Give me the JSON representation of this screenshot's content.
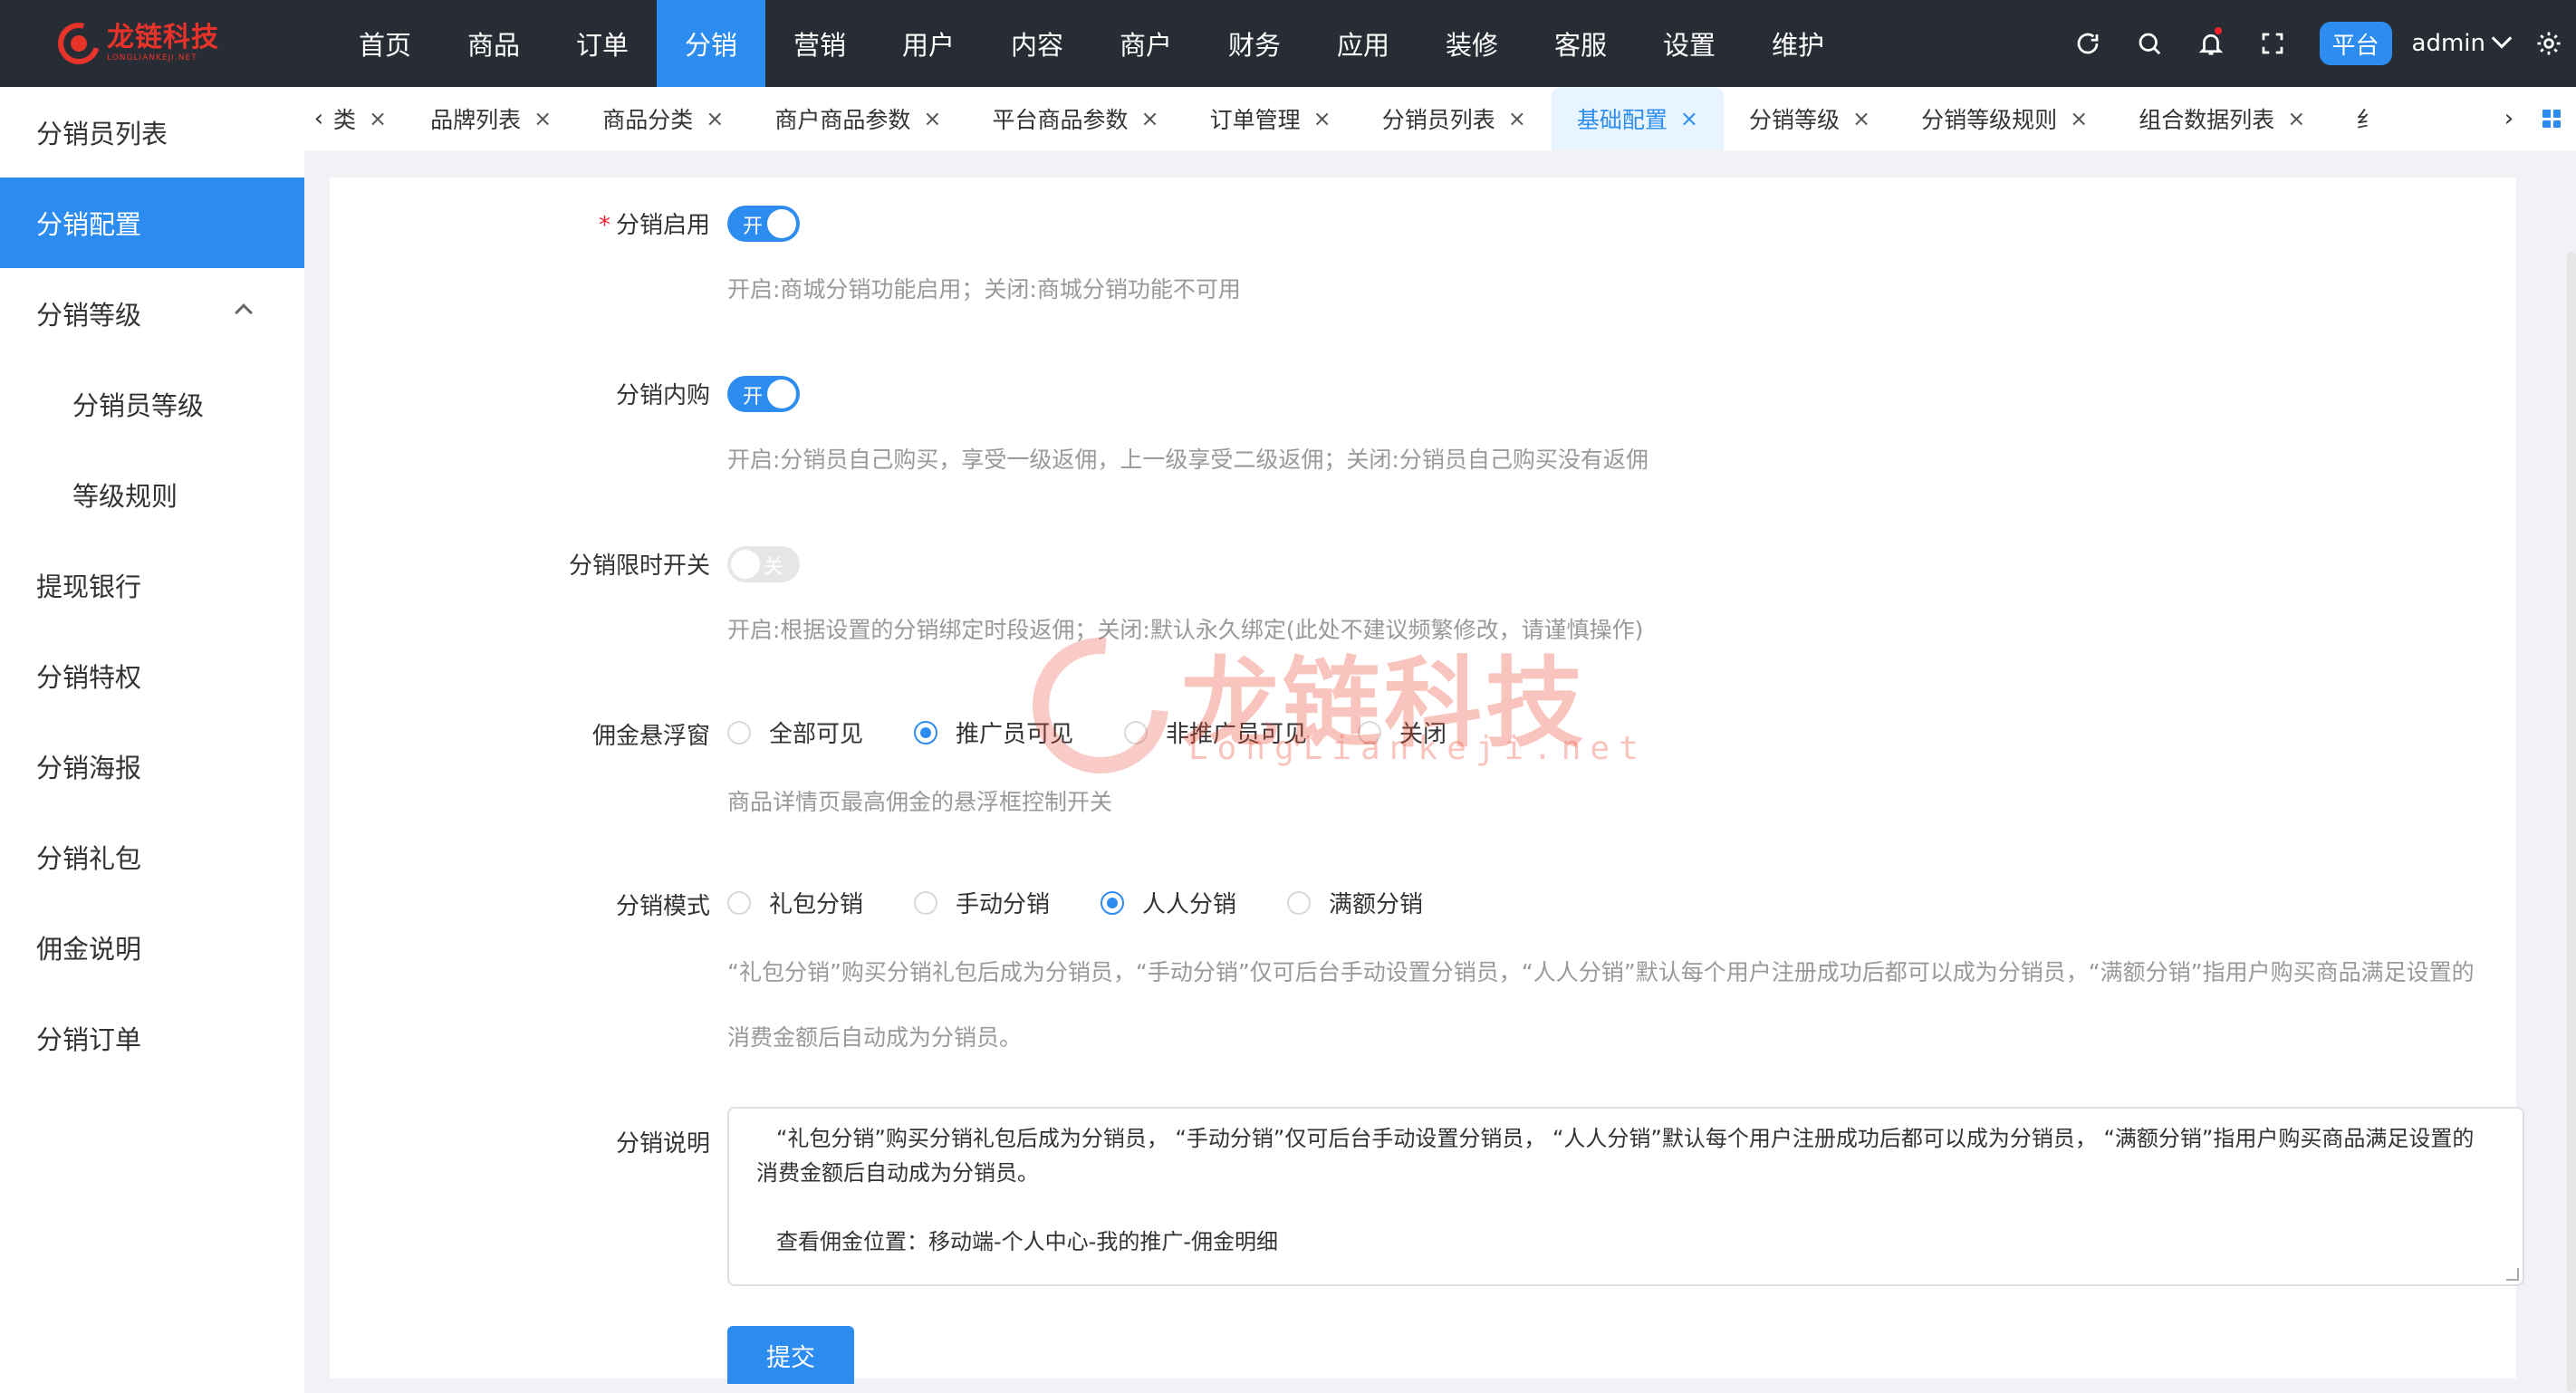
{
  "logo": {
    "name": "龙链科技",
    "subtitle": "LONGLIANKEJI.NET"
  },
  "topnav": [
    "首页",
    "商品",
    "订单",
    "分销",
    "营销",
    "用户",
    "内容",
    "商户",
    "财务",
    "应用",
    "装修",
    "客服",
    "设置",
    "维护"
  ],
  "topnav_active": "分销",
  "header": {
    "platform_label": "平台",
    "user": "admin"
  },
  "sidebar": {
    "items": [
      {
        "label": "分销员列表"
      },
      {
        "label": "分销配置"
      },
      {
        "label": "分销等级"
      },
      {
        "label": "分销员等级"
      },
      {
        "label": "等级规则"
      },
      {
        "label": "提现银行"
      },
      {
        "label": "分销特权"
      },
      {
        "label": "分销海报"
      },
      {
        "label": "分销礼包"
      },
      {
        "label": "佣金说明"
      },
      {
        "label": "分销订单"
      }
    ],
    "active": "分销配置"
  },
  "tabs": {
    "items": [
      "类",
      "品牌列表",
      "商品分类",
      "商户商品参数",
      "平台商品参数",
      "订单管理",
      "分销员列表",
      "基础配置",
      "分销等级",
      "分销等级规则",
      "组合数据列表",
      "纟"
    ],
    "active": "基础配置",
    "close_glyph": "×",
    "left_glyph": "‹",
    "right_glyph": "›"
  },
  "form": {
    "enable": {
      "label": "分销启用",
      "state": "开",
      "help": "开启:商城分销功能启用；关闭:商城分销功能不可用"
    },
    "inner_buy": {
      "label": "分销内购",
      "state": "开",
      "help": "开启:分销员自己购买，享受一级返佣，上一级享受二级返佣；关闭:分销员自己购买没有返佣"
    },
    "time_limit": {
      "label": "分销限时开关",
      "state": "关",
      "help": "开启:根据设置的分销绑定时段返佣；关闭:默认永久绑定(此处不建议频繁修改，请谨慎操作)"
    },
    "float_window": {
      "label": "佣金悬浮窗",
      "options": [
        "全部可见",
        "推广员可见",
        "非推广员可见",
        "关闭"
      ],
      "selected": "推广员可见",
      "help": "商品详情页最高佣金的悬浮框控制开关"
    },
    "mode": {
      "label": "分销模式",
      "options": [
        "礼包分销",
        "手动分销",
        "人人分销",
        "满额分销"
      ],
      "selected": "人人分销",
      "help_line1": "“礼包分销”购买分销礼包后成为分销员，“手动分销”仅可后台手动设置分销员，“人人分销”默认每个用户注册成功后都可以成为分销员，“满额分销”指用户购买商品满足设置的",
      "help_line2": "消费金额后自动成为分销员。"
    },
    "description": {
      "label": "分销说明",
      "line1": "“礼包分销”购买分销礼包后成为分销员， “手动分销”仅可后台手动设置分销员， “人人分销”默认每个用户注册成功后都可以成为分销员， “满额分销”指用户购买商品满足设置的",
      "line2": "消费金额后自动成为分销员。",
      "line3": "查看佣金位置：移动端-个人中心-我的推广-佣金明细"
    },
    "submit_label": "提交"
  },
  "watermark": {
    "cn": "龙链科技",
    "en": "LongLiankeji.net"
  },
  "colors": {
    "primary": "#2d8cf0",
    "topbar": "#282c34",
    "logo_red": "#e8332a"
  }
}
